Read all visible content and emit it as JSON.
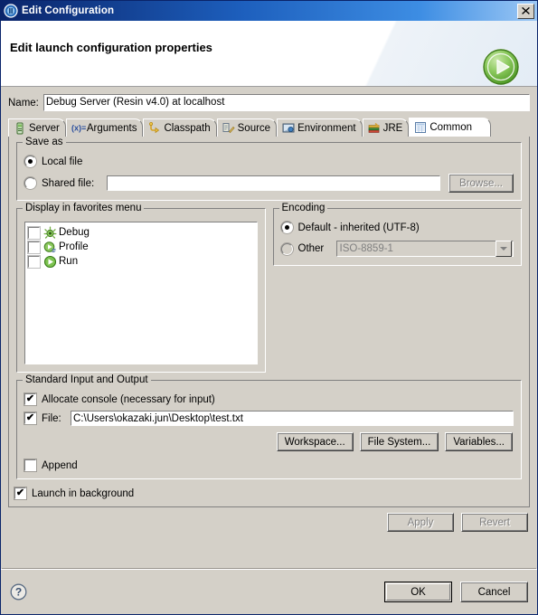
{
  "window": {
    "title": "Edit Configuration",
    "icon": "config-window-icon",
    "close_label": "✕"
  },
  "banner": {
    "heading": "Edit launch configuration properties",
    "icon": "run-launch-icon",
    "accent_green": "#5cb531"
  },
  "name_field": {
    "label": "Name:",
    "value": "Debug Server (Resin v4.0) at localhost",
    "placeholder": ""
  },
  "tabs": [
    {
      "label": "Server",
      "icon": "server-icon",
      "active": false
    },
    {
      "label": "Arguments",
      "icon": "arguments-icon",
      "active": false
    },
    {
      "label": "Classpath",
      "icon": "classpath-icon",
      "active": false
    },
    {
      "label": "Source",
      "icon": "source-icon",
      "active": false
    },
    {
      "label": "Environment",
      "icon": "environment-icon",
      "active": false
    },
    {
      "label": "JRE",
      "icon": "jre-icon",
      "active": false
    },
    {
      "label": "Common",
      "icon": "common-icon",
      "active": true
    }
  ],
  "save_as": {
    "legend": "Save as",
    "local_file": {
      "label": "Local file",
      "selected": true
    },
    "shared_file": {
      "label": "Shared file:",
      "selected": false,
      "value": "",
      "placeholder": ""
    },
    "browse_button": {
      "label": "Browse...",
      "enabled": false
    }
  },
  "favorites": {
    "legend": "Display in favorites menu",
    "items": [
      {
        "label": "Debug",
        "icon": "debug-icon",
        "checked": false
      },
      {
        "label": "Profile",
        "icon": "profile-icon",
        "checked": false
      },
      {
        "label": "Run",
        "icon": "run-icon",
        "checked": false
      }
    ]
  },
  "encoding": {
    "legend": "Encoding",
    "default_option": {
      "label": "Default - inherited (UTF-8)",
      "selected": true
    },
    "other_option": {
      "label": "Other",
      "selected": false
    },
    "other_combo": {
      "value": "ISO-8859-1",
      "enabled": false,
      "arrow_icon": "chevron-down-icon"
    }
  },
  "stdio": {
    "legend": "Standard Input and Output",
    "allocate_console": {
      "label": "Allocate console (necessary for input)",
      "checked": true
    },
    "file": {
      "label": "File:",
      "checked": true,
      "value": "C:\\Users\\okazaki.jun\\Desktop\\test.txt"
    },
    "buttons": [
      {
        "label": "Workspace...",
        "enabled": true
      },
      {
        "label": "File System...",
        "enabled": true
      },
      {
        "label": "Variables...",
        "enabled": true
      }
    ],
    "append": {
      "label": "Append",
      "checked": false
    }
  },
  "launch_in_background": {
    "label": "Launch in background",
    "checked": true
  },
  "action_buttons": [
    {
      "label": "Apply",
      "enabled": false
    },
    {
      "label": "Revert",
      "enabled": false
    }
  ],
  "footer": {
    "help_icon": "help-icon",
    "buttons": [
      {
        "label": "OK",
        "default": true
      },
      {
        "label": "Cancel",
        "default": false
      }
    ]
  },
  "checkmark": "✔"
}
